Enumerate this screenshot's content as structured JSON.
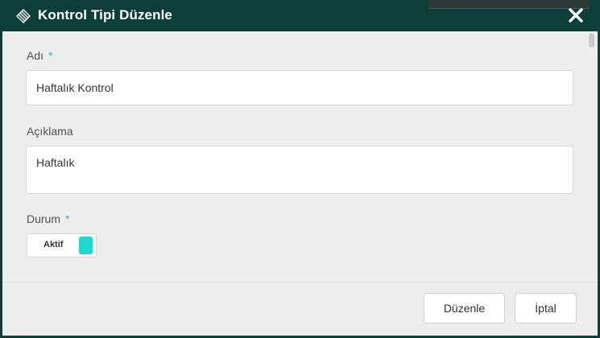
{
  "window": {
    "title": "Kontrol Tipi Düzenle",
    "logo_icon": "diamond-logo-icon",
    "close_icon": "close-icon"
  },
  "form": {
    "name": {
      "label": "Adı",
      "required_mark": "*",
      "value": "Haftalık Kontrol"
    },
    "description": {
      "label": "Açıklama",
      "value": "Haftalık"
    },
    "status": {
      "label": "Durum",
      "required_mark": "*",
      "toggle_label": "Aktif",
      "on": true
    }
  },
  "footer": {
    "edit_button": "Düzenle",
    "cancel_button": "İptal"
  },
  "colors": {
    "header_bg": "#0e3e3a",
    "accent": "#1bbfb3",
    "toggle_on": "#1ed8d0",
    "body_bg": "#ededed"
  }
}
